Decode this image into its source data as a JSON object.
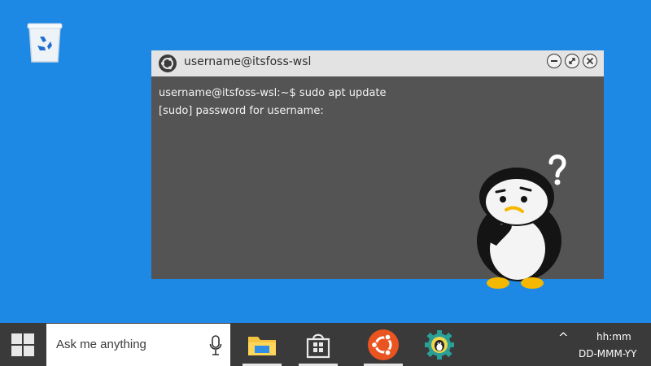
{
  "window": {
    "title": "username@itsfoss-wsl",
    "lines": [
      "username@itsfoss-wsl:~$ sudo apt update",
      "[sudo] password for username:"
    ]
  },
  "taskbar": {
    "search_placeholder": "Ask me anything",
    "time": "hh:mm",
    "date": "DD-MMM-YY",
    "tray_chevron": "^",
    "apps": [
      "file-explorer-icon",
      "store-icon",
      "ubuntu-icon",
      "wsl-gear-icon"
    ]
  },
  "colors": {
    "desktop": "#1e88e5",
    "terminal_bg": "#545454",
    "taskbar": "#3a3a3a",
    "ubuntu_orange": "#e95420"
  }
}
